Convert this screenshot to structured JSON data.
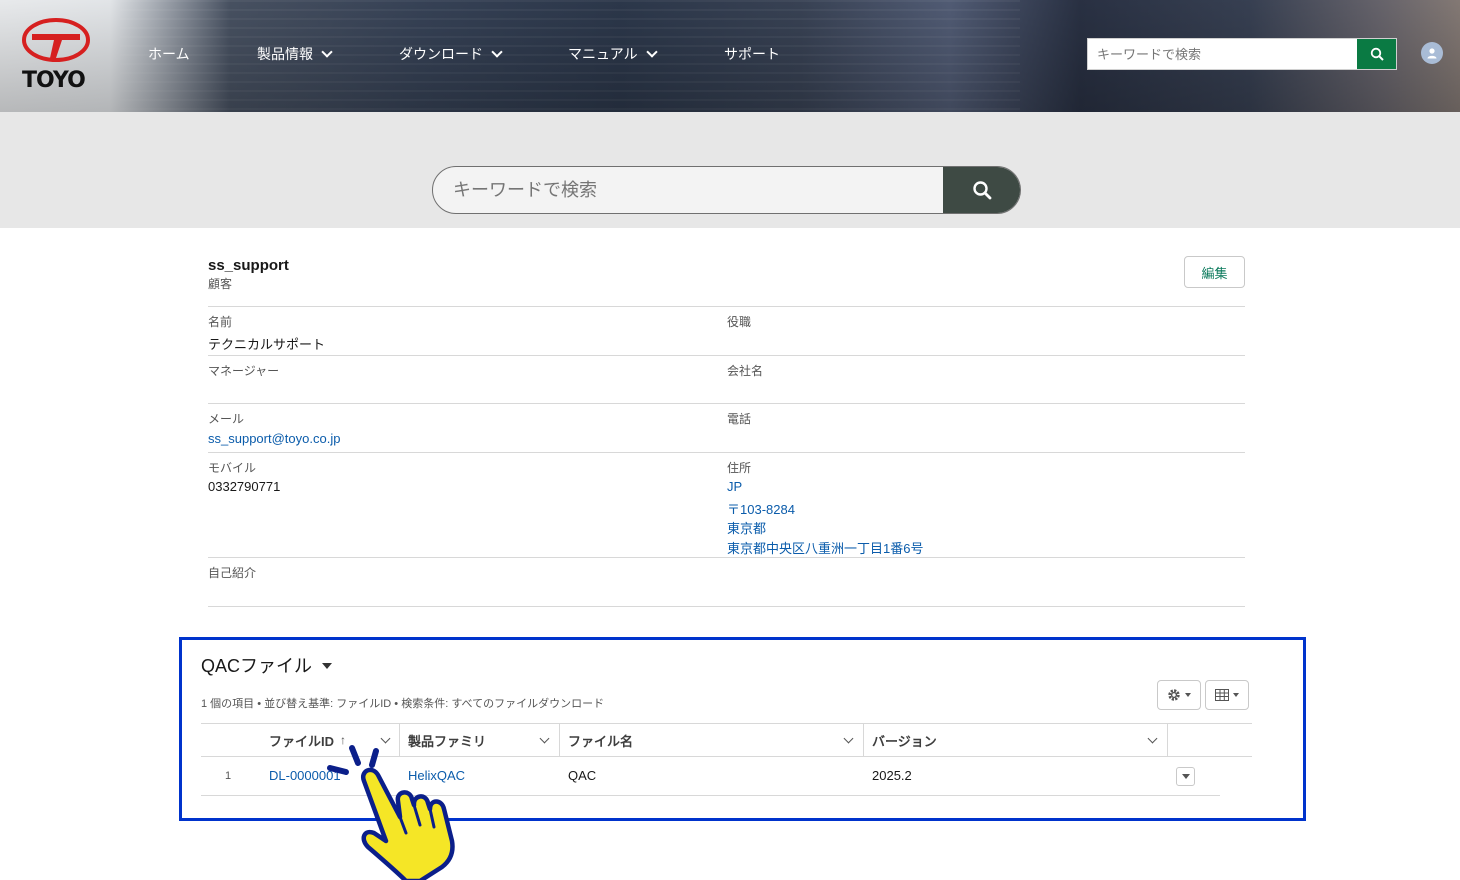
{
  "header": {
    "logo_text": "TOYO",
    "nav": [
      {
        "label": "ホーム",
        "has_dropdown": false
      },
      {
        "label": "製品情報",
        "has_dropdown": true
      },
      {
        "label": "ダウンロード",
        "has_dropdown": true
      },
      {
        "label": "マニュアル",
        "has_dropdown": true
      },
      {
        "label": "サポート",
        "has_dropdown": false
      }
    ],
    "search_placeholder": "キーワードで検索",
    "search_icon": "search-icon",
    "avatar_icon": "user-icon",
    "accent_color": "#0a7a43"
  },
  "band": {
    "search_placeholder": "キーワードで検索",
    "search_icon": "search-icon"
  },
  "profile": {
    "username": "ss_support",
    "role": "顧客",
    "edit_label": "編集",
    "fields": {
      "name_label": "名前",
      "name_value": "テクニカルサポート",
      "title_label": "役職",
      "title_value": "",
      "manager_label": "マネージャー",
      "manager_value": "",
      "company_label": "会社名",
      "company_value": "",
      "email_label": "メール",
      "email_value": "ss_support@toyo.co.jp",
      "phone_label": "電話",
      "phone_value": "",
      "mobile_label": "モバイル",
      "mobile_value": "0332790771",
      "address_label": "住所",
      "address_lines": [
        "JP",
        "〒103-8284",
        "東京都",
        "東京都中央区八重洲一丁目1番6号"
      ],
      "bio_label": "自己紹介",
      "bio_value": ""
    }
  },
  "list": {
    "title": "QACファイル",
    "meta": "1 個の項目 • 並び替え基準: ファイルID • 検索条件: すべてのファイルダウンロード",
    "settings_icon": "gear-icon",
    "view_icon": "table-icon",
    "columns": [
      "ファイルID",
      "製品ファミリ",
      "ファイル名",
      "バージョン"
    ],
    "sort_indicator": "↑",
    "rows": [
      {
        "num": "1",
        "file_id": "DL-0000001",
        "family": "HelixQAC",
        "file_name": "QAC",
        "version": "2025.2"
      }
    ],
    "highlight_color": "#0033cc"
  },
  "annotation": {
    "pointer_icon": "pointing-hand-icon",
    "pointer_color": "#f5e626"
  }
}
